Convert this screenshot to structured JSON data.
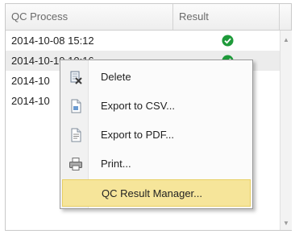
{
  "table": {
    "columns": [
      "QC Process",
      "Result",
      ""
    ],
    "rows": [
      {
        "datetime": "2014-10-08 15:12",
        "result": "pass"
      },
      {
        "datetime": "2014-10-10 10:16",
        "result": "pass"
      },
      {
        "datetime": "2014-10",
        "result": ""
      },
      {
        "datetime": "2014-10",
        "result": ""
      }
    ]
  },
  "context_menu": {
    "items": [
      {
        "label": "Delete",
        "icon": "delete-icon"
      },
      {
        "label": "Export to CSV...",
        "icon": "csv-file-icon"
      },
      {
        "label": "Export to PDF...",
        "icon": "pdf-file-icon"
      },
      {
        "label": "Print...",
        "icon": "printer-icon"
      },
      {
        "label": "QC Result Manager...",
        "icon": ""
      }
    ],
    "highlighted_index": 4
  },
  "colors": {
    "result_pass": "#1e9a3a",
    "menu_highlight": "#f6e59a"
  }
}
